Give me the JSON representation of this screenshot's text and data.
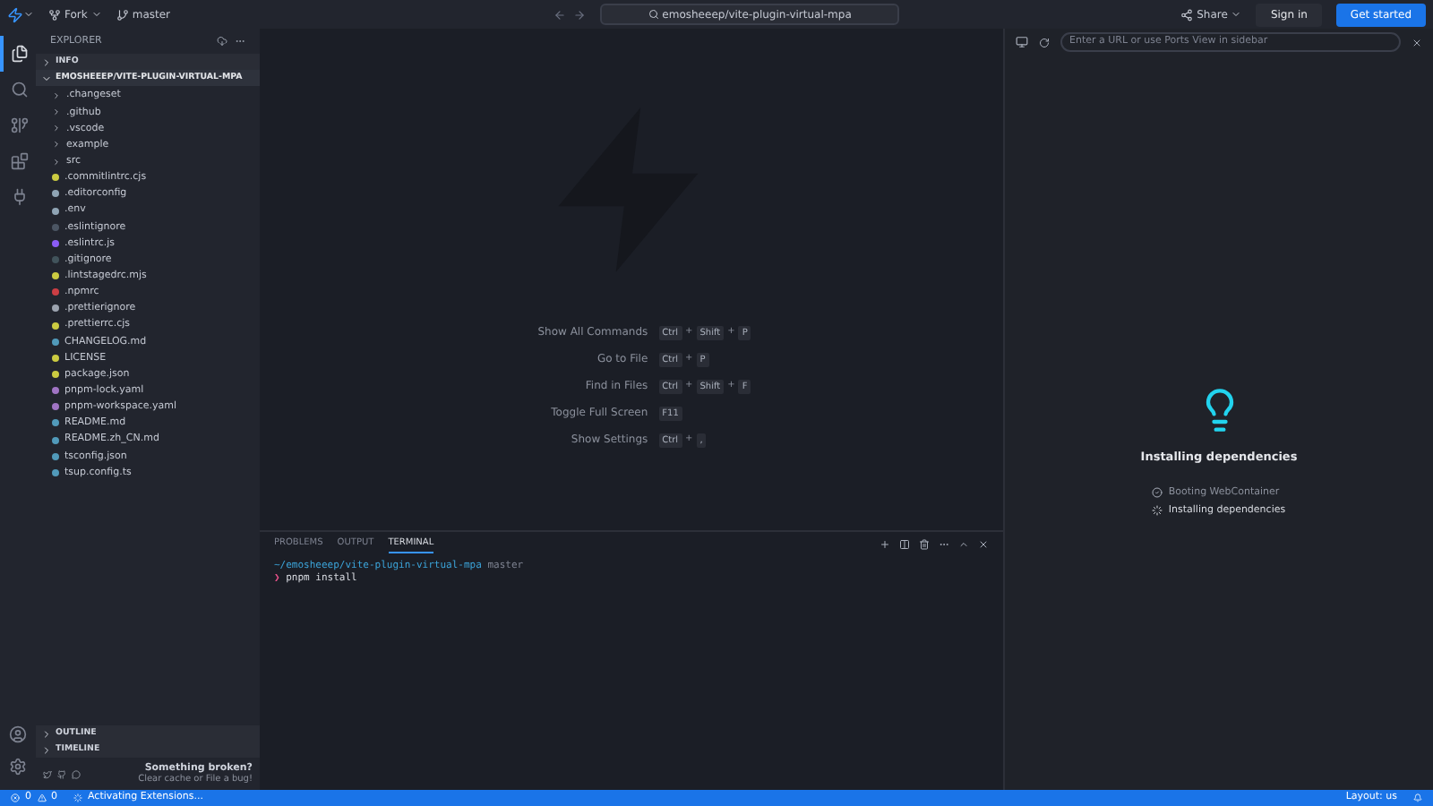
{
  "top_bar": {
    "fork_label": "Fork",
    "branch": "master",
    "search_value": "emosheeep/vite-plugin-virtual-mpa",
    "share": "Share",
    "sign_in": "Sign in",
    "get_started": "Get started"
  },
  "activity_bar": [
    {
      "kind": "files",
      "selected": true
    },
    {
      "kind": "search",
      "selected": false
    },
    {
      "kind": "source-control",
      "selected": false
    },
    {
      "kind": "extensions",
      "selected": false
    },
    {
      "kind": "plug",
      "selected": false
    }
  ],
  "explorer": {
    "title": "EXPLORER",
    "sections": [
      {
        "label": "INFO",
        "expanded": false
      },
      {
        "label": "EMOSHEEEP/VITE-PLUGIN-VIRTUAL-MPA",
        "expanded": true
      }
    ],
    "files": [
      {
        "kind": "folder",
        "name": ".changeset"
      },
      {
        "kind": "folder",
        "name": ".github"
      },
      {
        "kind": "folder",
        "name": ".vscode"
      },
      {
        "kind": "folder",
        "name": "example"
      },
      {
        "kind": "folder",
        "name": "src"
      },
      {
        "kind": "file",
        "name": ".commitlintrc.cjs",
        "color": "#cbcb41"
      },
      {
        "kind": "file",
        "name": ".editorconfig",
        "color": "#8fa4b4"
      },
      {
        "kind": "file",
        "name": ".env",
        "color": "#8fa4b4"
      },
      {
        "kind": "file",
        "name": ".eslintignore",
        "color": "#4b5563"
      },
      {
        "kind": "file",
        "name": ".eslintrc.js",
        "color": "#8b5cf6"
      },
      {
        "kind": "file",
        "name": ".gitignore",
        "color": "#41535b"
      },
      {
        "kind": "file",
        "name": ".lintstagedrc.mjs",
        "color": "#cbcb41"
      },
      {
        "kind": "file",
        "name": ".npmrc",
        "color": "#cc3e44"
      },
      {
        "kind": "file",
        "name": ".prettierignore",
        "color": "#9ca3af"
      },
      {
        "kind": "file",
        "name": ".prettierrc.cjs",
        "color": "#cbcb41"
      },
      {
        "kind": "file",
        "name": "CHANGELOG.md",
        "color": "#519aba"
      },
      {
        "kind": "file",
        "name": "LICENSE",
        "color": "#cbcb41"
      },
      {
        "kind": "file",
        "name": "package.json",
        "color": "#cbcb41"
      },
      {
        "kind": "file",
        "name": "pnpm-lock.yaml",
        "color": "#a074c4"
      },
      {
        "kind": "file",
        "name": "pnpm-workspace.yaml",
        "color": "#a074c4"
      },
      {
        "kind": "file",
        "name": "README.md",
        "color": "#519aba"
      },
      {
        "kind": "file",
        "name": "README.zh_CN.md",
        "color": "#519aba"
      },
      {
        "kind": "file",
        "name": "tsconfig.json",
        "color": "#519aba"
      },
      {
        "kind": "file",
        "name": "tsup.config.ts",
        "color": "#519aba"
      }
    ],
    "bottom_sections": [
      {
        "label": "OUTLINE",
        "expanded": false
      },
      {
        "label": "TIMELINE",
        "expanded": false
      }
    ],
    "footer": {
      "title": "Something broken?",
      "text": "Clear cache or File a bug!"
    }
  },
  "shortcuts": [
    {
      "label": "Show All Commands",
      "tokens": [
        {
          "kind": "key",
          "text": "Ctrl"
        },
        {
          "kind": "plus",
          "text": "+"
        },
        {
          "kind": "key",
          "text": "Shift"
        },
        {
          "kind": "plus",
          "text": "+"
        },
        {
          "kind": "key",
          "text": "P"
        }
      ]
    },
    {
      "label": "Go to File",
      "tokens": [
        {
          "kind": "key",
          "text": "Ctrl"
        },
        {
          "kind": "plus",
          "text": "+"
        },
        {
          "kind": "key",
          "text": "P"
        }
      ]
    },
    {
      "label": "Find in Files",
      "tokens": [
        {
          "kind": "key",
          "text": "Ctrl"
        },
        {
          "kind": "plus",
          "text": "+"
        },
        {
          "kind": "key",
          "text": "Shift"
        },
        {
          "kind": "plus",
          "text": "+"
        },
        {
          "kind": "key",
          "text": "F"
        }
      ]
    },
    {
      "label": "Toggle Full Screen",
      "tokens": [
        {
          "kind": "key",
          "text": "F11"
        }
      ]
    },
    {
      "label": "Show Settings",
      "tokens": [
        {
          "kind": "key",
          "text": "Ctrl"
        },
        {
          "kind": "plus",
          "text": "+"
        },
        {
          "kind": "key",
          "text": ","
        }
      ]
    }
  ],
  "panel": {
    "tabs": [
      {
        "label": "PROBLEMS",
        "selected": false
      },
      {
        "label": "OUTPUT",
        "selected": false
      },
      {
        "label": "TERMINAL",
        "selected": true
      }
    ],
    "terminal": {
      "path": "~/emosheeep/vite-plugin-virtual-mpa",
      "branch": "master",
      "prompt": "❯",
      "command": "pnpm install"
    }
  },
  "preview": {
    "url_placeholder": "Enter a URL or use Ports View in sidebar",
    "title": "Installing dependencies",
    "steps": [
      {
        "label": "Booting WebContainer",
        "done": true
      },
      {
        "label": "Installing dependencies",
        "done": false
      }
    ]
  },
  "status_bar": {
    "errors": "0",
    "warnings": "0",
    "message": "Activating Extensions...",
    "layout": "Layout: us"
  }
}
